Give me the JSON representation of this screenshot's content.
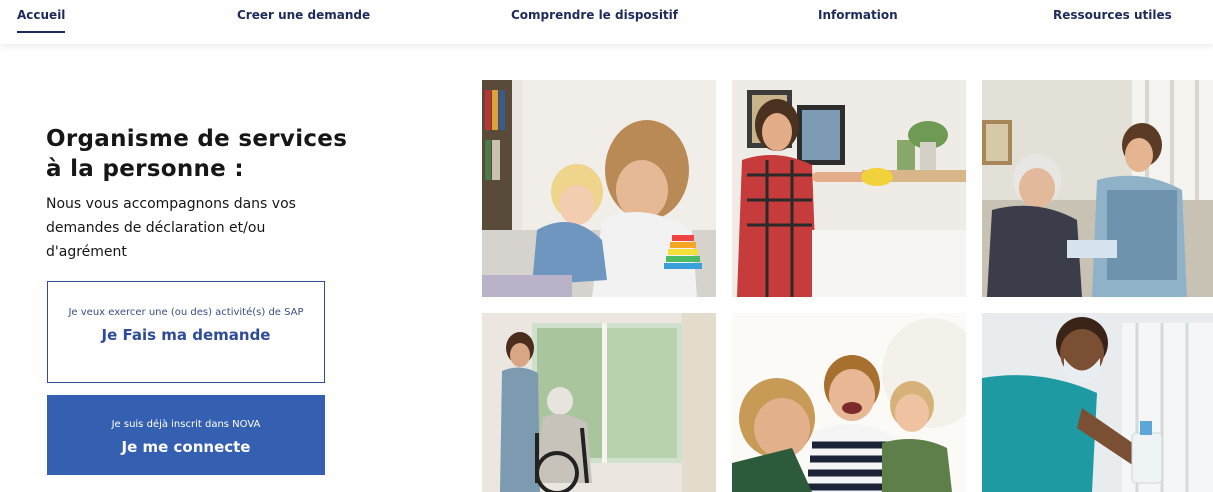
{
  "nav": {
    "items": [
      {
        "label": "Accueil",
        "active": true
      },
      {
        "label": "Creer une demande",
        "active": false
      },
      {
        "label": "Comprendre le dispositif",
        "active": false
      },
      {
        "label": "Information",
        "active": false
      },
      {
        "label": "Ressources utiles",
        "active": false
      }
    ]
  },
  "hero": {
    "title_line1": "Organisme de services",
    "title_line2": "à la personne :",
    "subtitle": "Nous vous accompagnons dans vos demandes de déclaration et/ou d'agrément"
  },
  "cta": {
    "request": {
      "small": "Je veux exercer une (ou des) activité(s) de SAP",
      "big": "Je Fais ma demande"
    },
    "login": {
      "small": "Je suis déjà inscrit dans NOVA",
      "big": "Je me connecte"
    }
  },
  "colors": {
    "nav_text": "#1e2a5a",
    "primary": "#355fb0",
    "outline": "#2f4c98"
  },
  "photos": [
    {
      "icon": "mother-child-drawing-photo"
    },
    {
      "icon": "woman-cleaning-photo"
    },
    {
      "icon": "caregiver-elderly-photo"
    },
    {
      "icon": "caregiver-wheelchair-photo"
    },
    {
      "icon": "family-laughing-photo"
    },
    {
      "icon": "masked-worker-cleaning-photo"
    }
  ]
}
